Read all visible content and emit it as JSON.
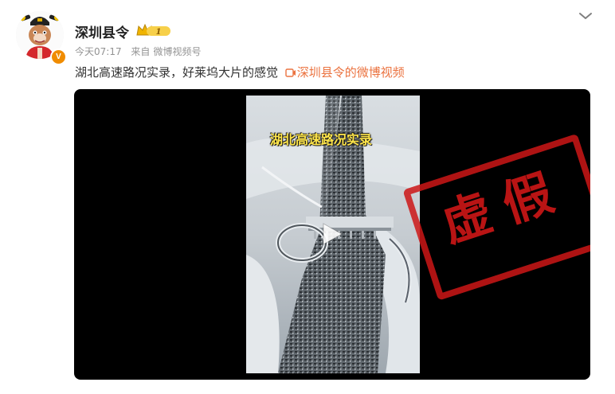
{
  "post": {
    "author": "深圳县令",
    "badge_level": "1",
    "verified_mark": "V",
    "time": "今天07:17",
    "source_prefix": "来自",
    "source": "微博视频号",
    "text": "湖北高速路况实录，好莱坞大片的感觉",
    "link_text": "深圳县令的微博视频"
  },
  "video": {
    "caption": "湖北高速路况实录",
    "stamp": "虚假"
  },
  "icons": {
    "more": "chevron-down-icon",
    "play": "play-icon",
    "link": "video-link-icon",
    "crown": "crown-badge-icon"
  },
  "colors": {
    "link": "#eb7340",
    "stamp": "#cd1616",
    "caption": "#ffe64b",
    "badge": "#f08c00"
  }
}
